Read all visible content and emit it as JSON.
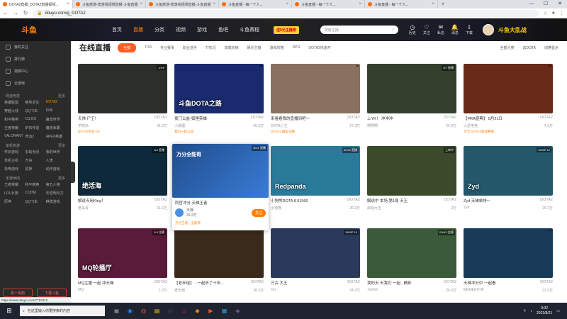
{
  "browser": {
    "tabs": [
      {
        "title": "DOTA2直播_DOTA2直播视频...",
        "active": true
      },
      {
        "title": "斗鱼旅游-放游戏视频直播-斗鱼直播",
        "active": false
      },
      {
        "title": "斗鱼旅游-放游戏视频直播-斗鱼直播",
        "active": false
      },
      {
        "title": "斗鱼直播 - 每一个人...",
        "active": false
      },
      {
        "title": "斗鱼直播 - 每一个人...",
        "active": false
      },
      {
        "title": "斗鱼直播 - 每一个人...",
        "active": false
      }
    ],
    "new_tab": "+",
    "url": "douyu.com/g_DOTA2",
    "window_controls": [
      "—",
      "☐",
      "✕"
    ]
  },
  "site_header": {
    "logo": "斗鱼",
    "nav": [
      {
        "label": "首页",
        "active": false
      },
      {
        "label": "直播",
        "active": true
      },
      {
        "label": "分类",
        "active": false
      },
      {
        "label": "视频",
        "active": false
      },
      {
        "label": "游戏",
        "active": false
      },
      {
        "label": "鱼吧",
        "active": false
      },
      {
        "label": "斗鱼赛程",
        "active": false
      }
    ],
    "promo": "送5元主播券",
    "search_placeholder": "搜索主播",
    "icons": [
      {
        "label": "历史",
        "icon": "clock-icon"
      },
      {
        "label": "关注",
        "icon": "heart-icon"
      },
      {
        "label": "私信",
        "icon": "mail-icon"
      },
      {
        "label": "消息",
        "icon": "bell-icon"
      },
      {
        "label": "下载",
        "icon": "download-icon"
      }
    ],
    "banner": "斗鱼大乱战"
  },
  "sidebar": {
    "items": [
      {
        "label": "我的关注"
      },
      {
        "label": "排行榜"
      },
      {
        "label": "视频中心"
      },
      {
        "label": "云游戏"
      }
    ],
    "sections": [
      {
        "title": "网游竞技",
        "more": "更多",
        "games": [
          "英雄联盟",
          "绝地求生",
          "DOTA2",
          "穿越火线",
          "QQ飞车",
          "DNF",
          "和平精英",
          "CS:GO",
          "魔兽世界",
          "王者荣耀",
          "炉石传说",
          "魔兽争霸",
          "VALORANT",
          "命运2",
          "APEX英雄"
        ],
        "highlight": "DOTA2"
      },
      {
        "title": "单机热游",
        "more": "更多",
        "games": [
          "怀旧游戏",
          "永劫无间",
          "我的世界",
          "单机主机",
          "方舟",
          "人渣",
          "恐怖游戏",
          "原神",
          "动作游戏"
        ],
        "highlight": ""
      },
      {
        "title": "手游休闲",
        "more": "更多",
        "games": [
          "王者荣耀",
          "和平精英",
          "第五人格",
          "LOL手游",
          "CODM",
          "天涯明月刀",
          "原神",
          "QQ飞车",
          "棋牌游戏"
        ],
        "highlight": ""
      }
    ],
    "buttons": [
      "看一看剧",
      "下载斗鱼"
    ]
  },
  "content": {
    "title": "在线直播",
    "filters": [
      {
        "label": "全部",
        "active": true
      },
      {
        "label": "TI10",
        "active": false
      },
      {
        "label": "专业赛事",
        "active": false
      },
      {
        "label": "职业选手",
        "active": false
      },
      {
        "label": "TI实况",
        "active": false
      },
      {
        "label": "高端天梯",
        "active": false
      },
      {
        "label": "娱乐主播",
        "active": false
      },
      {
        "label": "游戏攻略",
        "active": false
      },
      {
        "label": "RPG",
        "active": false
      },
      {
        "label": "DOTA2快速开",
        "active": false
      }
    ],
    "right_links": [
      "全部分类",
      "去DOTA",
      "切换显示"
    ]
  },
  "cards": [
    {
      "title": "天帅 尸王！",
      "cat": "DOTA2",
      "streamer": "学院派",
      "viewers": "41.2万",
      "tag": "1/1/9",
      "big": "",
      "note": "DOTA2综合·VS",
      "bg": "#2a2f2a"
    },
    {
      "title": "夜门公益-狐狸英雄",
      "cat": "DOTA2",
      "streamer": "小狐狸",
      "viewers": "40.3万",
      "tag": "",
      "big": "斗鱼DOTA之路",
      "note": "我们一起公益",
      "bg": "#1a2a6e"
    },
    {
      "title": "来看看我的直播间吧～",
      "cat": "DOTA2",
      "streamer": "DOTA小王",
      "viewers": "27.3万",
      "tag": "",
      "big": "",
      "note": "DOTA2 最美主播",
      "bg": "#8a7060"
    },
    {
      "title": "上YK！ 冲冲冲",
      "cat": "DOTA2",
      "streamer": "啊啊啊",
      "viewers": "24.9万",
      "tag": "5/7 直播",
      "big": "",
      "note": "",
      "bg": "#33402e"
    },
    {
      "title": "【PRA盛典】 8月21日",
      "cat": "DOTA2",
      "streamer": "火星电竞",
      "viewers": "4.3万",
      "tag": "",
      "big": "",
      "note": "大卡 DOTA2新冠赛事",
      "bg": "#6a2a1a"
    },
    {
      "title": "解说专用King！",
      "cat": "DOTA2",
      "streamer": "老哥哥",
      "viewers": "31.6万",
      "tag": "6/4 直播",
      "big": "绝活海",
      "note": "",
      "bg": "#0e2a3a"
    },
    {
      "title": "小狗熊DOTA 8 91966",
      "cat": "DOTA2",
      "streamer": "小狗熊",
      "viewers": "20.3万",
      "tag": "20:22 直播",
      "big": "Redpanda",
      "note": "",
      "bg": "#2a7a9a"
    },
    {
      "title": "解说中 本场 第1局 天王",
      "cat": "DOTA2",
      "streamer": "启动大王",
      "viewers": "2万",
      "tag": "上单中",
      "big": "",
      "note": "",
      "bg": "#3a4a2a"
    },
    {
      "title": "Zyd 天梯单排～",
      "cat": "DOTA2",
      "streamer": "Zyd",
      "viewers": "26.7万",
      "tag": "1000P 10",
      "big": "Zyd",
      "note": "",
      "bg": "#24586a"
    },
    {
      "title": "MQ主播 一起 冲天梯",
      "cat": "DOTA2",
      "streamer": "MQ",
      "viewers": "1.2万",
      "tag": "9.5 比赛",
      "big": "MQ轮播厅",
      "note": "",
      "bg": "#5a1a3a"
    },
    {
      "title": "【老年组】 - 一起听了十年...",
      "cat": "DOTA2",
      "streamer": "老年组",
      "viewers": "28.2万",
      "tag": "",
      "big": "",
      "note": "",
      "bg": "#3a2a1a"
    },
    {
      "title": "万古 大王",
      "cat": "DOTA2",
      "streamer": "mrr",
      "viewers": "24.2万",
      "tag": "1000P 10",
      "big": "",
      "note": "",
      "bg": "#2a3a5a"
    },
    {
      "title": "我的天 天我们 一起...精彩",
      "cat": "DOTA2",
      "streamer": "7anlo6",
      "viewers": "26.6万",
      "tag": "2/10/1 比赛",
      "big": "",
      "note": "",
      "bg": "#3a5a3a"
    },
    {
      "title": "天梯冲分中 一起看",
      "cat": "DOTA2",
      "streamer": "MEMEDOTA",
      "viewers": "22.3万",
      "tag": "",
      "big": "",
      "note": "",
      "bg": "#1a3a5a"
    }
  ],
  "hover_card": {
    "title": "阿哲冲分 天梯王者",
    "streamer": "天梯",
    "viewers": "29.2万",
    "follow": "关注",
    "tag": "4/0/1 直播",
    "big": "万分全能哥",
    "note": "万分王者，全能哥"
  },
  "status_url": "https://www.douyu.com/7710343",
  "taskbar": {
    "search_placeholder": "在这里输入你要搜索的内容",
    "time": "0:02",
    "date": "2021/8/21",
    "apps": [
      "task-view-icon",
      "edge-icon",
      "chrome-icon",
      "files-icon",
      "steam-icon",
      "music-icon",
      "game-icon",
      "media-icon",
      "store-icon",
      "app-icon"
    ]
  },
  "colors": {
    "accent": "#ff7f00",
    "active_filter": "#ff5d23",
    "sidebar_bg": "#2b2b2b",
    "taskbar_bg": "#1f2430"
  }
}
